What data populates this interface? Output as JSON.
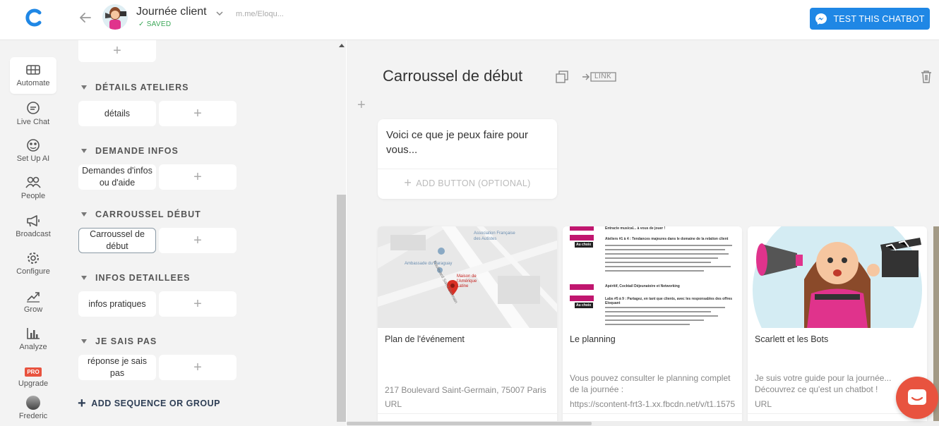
{
  "header": {
    "bot_name": "Journée client",
    "saved_label": "SAVED",
    "bot_url": "m.me/Eloqu...",
    "test_button_label": "TEST THIS CHATBOT",
    "brand_color": "#1f87e5"
  },
  "nav": {
    "items": [
      {
        "label": "Automate",
        "icon": "automate-icon",
        "active": true
      },
      {
        "label": "Live Chat",
        "icon": "chat-bubble-icon"
      },
      {
        "label": "Set Up AI",
        "icon": "ai-icon"
      },
      {
        "label": "People",
        "icon": "people-icon"
      },
      {
        "label": "Broadcast",
        "icon": "megaphone-icon"
      },
      {
        "label": "Configure",
        "icon": "gear-icon"
      },
      {
        "label": "Grow",
        "icon": "grow-icon"
      },
      {
        "label": "Analyze",
        "icon": "bar-chart-icon"
      },
      {
        "label": "Upgrade",
        "badge": "PRO"
      },
      {
        "label": "Frederic",
        "icon": "user-avatar"
      }
    ]
  },
  "sequences": {
    "groups": [
      {
        "title": "DÉTAILS ATELIERS",
        "items": [
          "détails"
        ]
      },
      {
        "title": "DEMANDE INFOS",
        "items": [
          "Demandes d'infos ou d'aide"
        ]
      },
      {
        "title": "CARROUSSEL DÉBUT",
        "items": [
          "Carroussel de début"
        ]
      },
      {
        "title": "INFOS DETAILLEES",
        "items": [
          "infos pratiques"
        ]
      },
      {
        "title": "JE SAIS PAS",
        "items": [
          "réponse je sais pas"
        ]
      }
    ],
    "add_label": "ADD SEQUENCE OR GROUP"
  },
  "editor": {
    "title": "Carroussel de début",
    "link_label": "LINK",
    "text_card": {
      "message": "Voici ce que je peux faire pour vous...",
      "add_button_label": "ADD BUTTON (OPTIONAL)"
    },
    "gallery": [
      {
        "title": "Plan de l'événement",
        "subtitle": "217 Boulevard Saint-Germain, 75007 Paris",
        "url": "URL"
      },
      {
        "title": "Le planning",
        "subtitle": "Vous pouvez consulter le planning complet de la journée :",
        "url": "https://scontent-frt3-1.xx.fbcdn.net/v/t1.1575"
      },
      {
        "title": "Scarlett et les Bots",
        "subtitle": "Je suis votre guide pour la journée... Découvrez ce qu'est un chatbot !",
        "url": "URL"
      }
    ]
  },
  "map_labels": {
    "street1": "Boulevard Saint-Germain",
    "place1": "Association Française des Autistes",
    "place2": "Ambassade du Paraguay",
    "place3": "Maison de l'Amérique Latine"
  },
  "planning_labels": {
    "line1": "Entracte musical... à vous de jouer !",
    "line2": "Ateliers #1 à 4 : Tendances majeures dans le domaine de la relation client",
    "line3": "Apéritif, Cocktail Déjeunatoire et Networking",
    "line4": "Labs #5 à 9 : Partagez, en tant que clients, avec les responsables des offres Eloquant",
    "badge": "Au choix"
  }
}
